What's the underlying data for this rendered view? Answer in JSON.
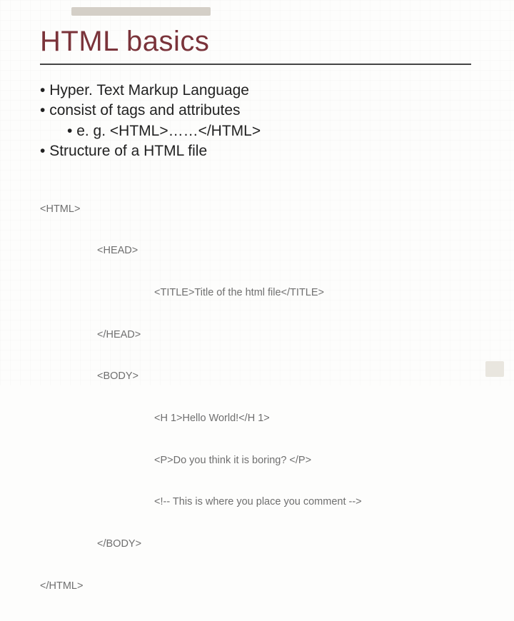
{
  "title": "HTML basics",
  "bullets": {
    "b0": "Hyper. Text Markup Language",
    "b1": "consist of tags and attributes",
    "b2": "e. g. <HTML>……</HTML>",
    "b3": "Structure of a HTML file"
  },
  "code": {
    "l0": "<HTML>",
    "l1": "<HEAD>",
    "l2": "<TITLE>Title of the html file</TITLE>",
    "l3": "</HEAD>",
    "l4": "<BODY>",
    "l5": "<H 1>Hello World!</H 1>",
    "l6": "<P>Do you think it is boring? </P>",
    "l7": "<!-- This is where you place you comment -->",
    "l8": "</BODY>",
    "l9": "</HTML>"
  }
}
